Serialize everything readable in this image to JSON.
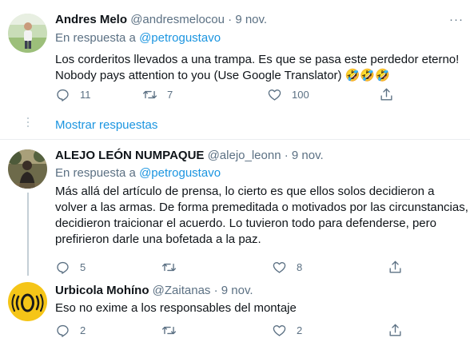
{
  "tweets": [
    {
      "name": "Andres Melo",
      "handle": "@andresmelocou",
      "separator": "·",
      "date": "9 nov.",
      "reply_prefix": "En respuesta a",
      "reply_to": "@petrogustavo",
      "text_lines": [
        "Los corderitos llevados a una trampa. Es que se pasa este perdedor eterno!",
        "Nobody pays attention to you (Use Google Translator) 🤣🤣🤣"
      ],
      "replies": "11",
      "retweets": "7",
      "likes": "100",
      "avatar": "avatar-person-standing"
    },
    {
      "name": "ALEJO LEÓN NUMPAQUE",
      "handle": "@alejo_leonn",
      "separator": "·",
      "date": "9 nov.",
      "reply_prefix": "En respuesta a",
      "reply_to": "@petrogustavo",
      "text_lines": [
        "Más allá del artículo de prensa, lo cierto es que ellos solos decidieron a",
        "volver a las armas. De forma premeditada o motivados por las circunstancias,",
        "decidieron traicionar el acuerdo. Lo tuvieron todo para defenderse, pero",
        "prefirieron darle una bofetada a la paz."
      ],
      "replies": "5",
      "retweets": "",
      "likes": "8",
      "avatar": "avatar-person-outdoors"
    },
    {
      "name": "Urbicola Mohíno",
      "handle": "@Zaitanas",
      "separator": "·",
      "date": "9 nov.",
      "text_lines": [
        "Eso no exime a los responsables del  montaje"
      ],
      "replies": "2",
      "retweets": "",
      "likes": "2",
      "avatar": "avatar-yellow-face"
    }
  ],
  "more_label": "···",
  "show_replies_label": "Mostrar respuestas",
  "colors": {
    "accent": "#1b95e0",
    "secondary_text": "#5b7083",
    "divider": "#ebeef0"
  },
  "icons": [
    "reply-icon",
    "retweet-icon",
    "like-icon",
    "share-icon",
    "more-icon"
  ]
}
